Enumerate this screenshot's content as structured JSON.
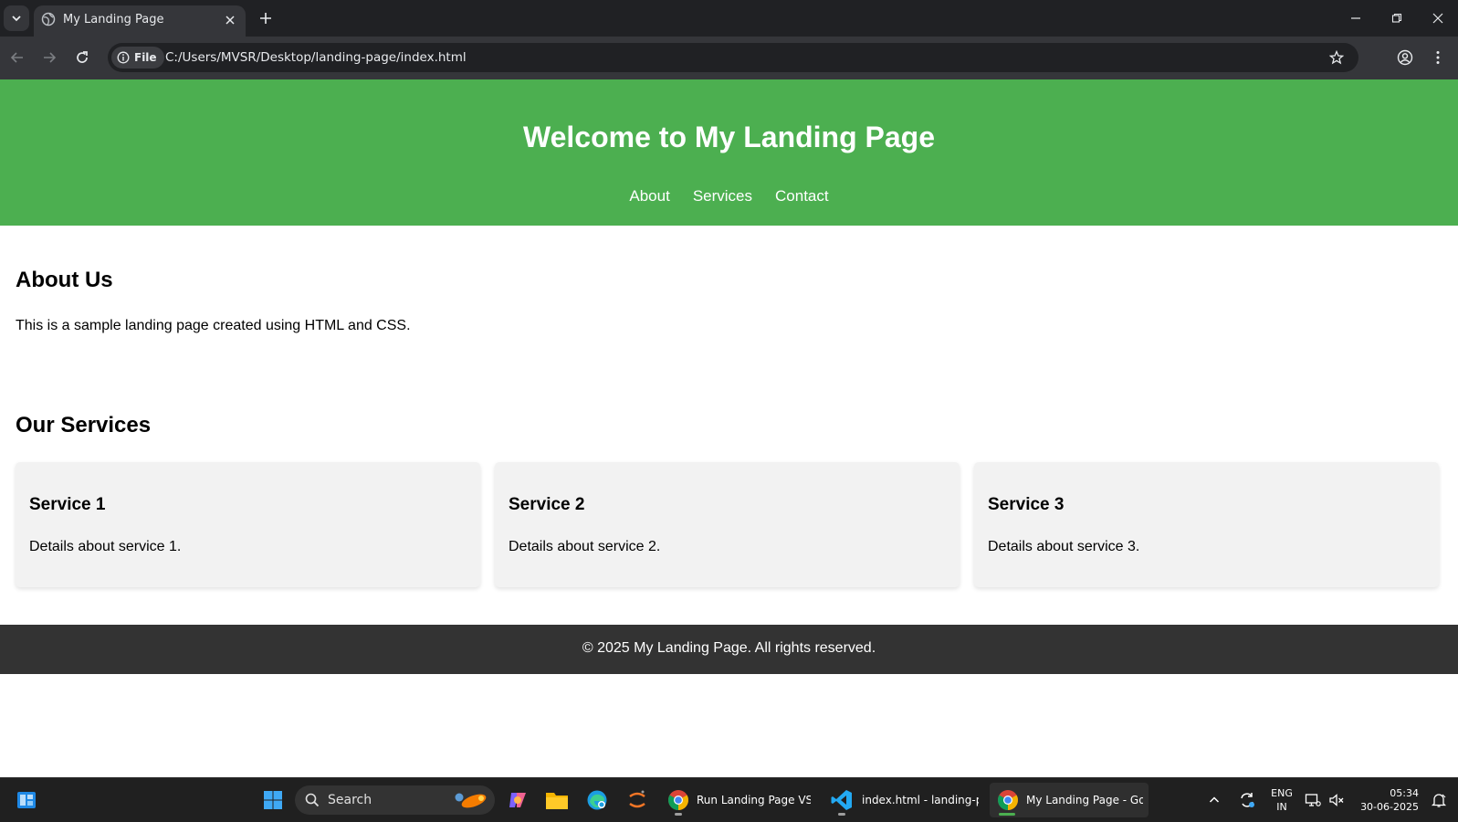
{
  "browser": {
    "tab_title": "My Landing Page",
    "address_chip": "File",
    "url": "C:/Users/MVSR/Desktop/landing-page/index.html"
  },
  "site": {
    "title": "Welcome to My Landing Page",
    "nav": [
      "About",
      "Services",
      "Contact"
    ],
    "about": {
      "heading": "About Us",
      "text": "This is a sample landing page created using HTML and CSS."
    },
    "services": {
      "heading": "Our Services",
      "items": [
        {
          "title": "Service 1",
          "text": "Details about service 1."
        },
        {
          "title": "Service 2",
          "text": "Details about service 2."
        },
        {
          "title": "Service 3",
          "text": "Details about service 3."
        }
      ]
    },
    "footer": "© 2025 My Landing Page. All rights reserved."
  },
  "taskbar": {
    "search_label": "Search",
    "apps": [
      {
        "label": "Run Landing Page VS Co"
      },
      {
        "label": "index.html - landing-pa"
      },
      {
        "label": "My Landing Page - Goo"
      }
    ],
    "tray": {
      "language_line1": "ENG",
      "language_line2": "IN",
      "time": "05:34",
      "date": "30-06-2025"
    }
  },
  "colors": {
    "header_green": "#4caf50",
    "footer_dark": "#333333",
    "card_bg": "#f2f2f2"
  }
}
